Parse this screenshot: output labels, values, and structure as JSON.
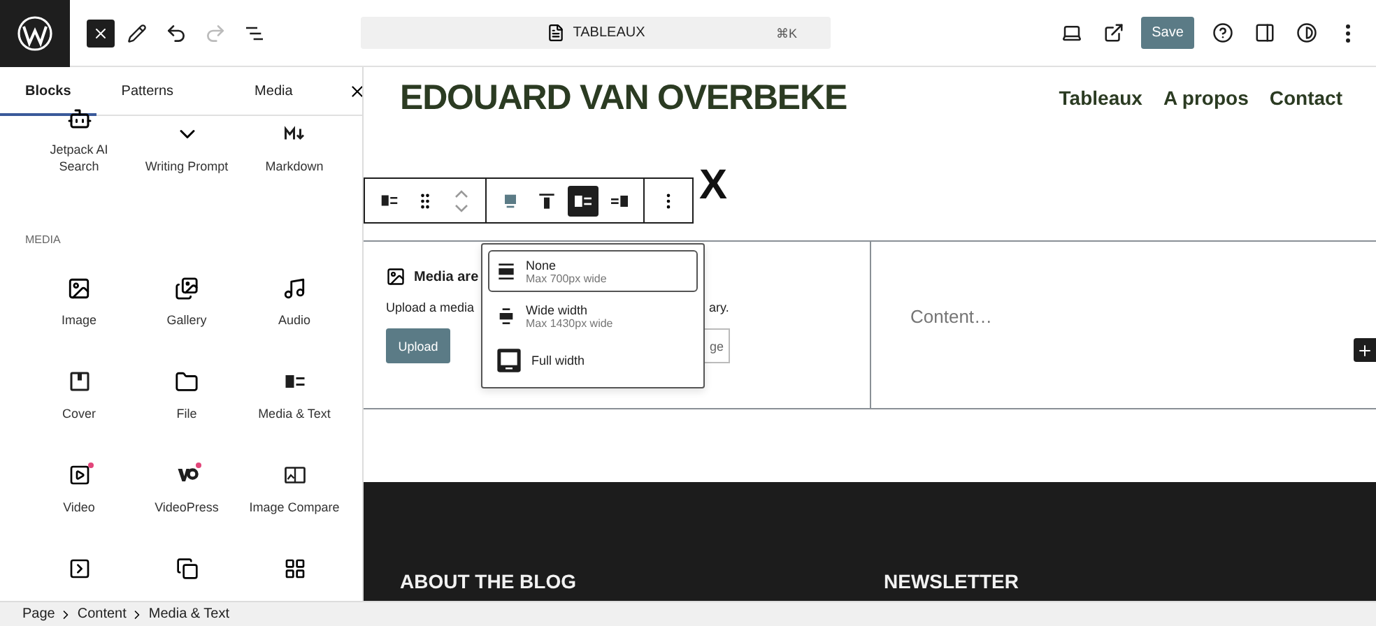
{
  "topbar": {
    "command": "TABLEAUX",
    "shortcut": "⌘K",
    "save": "Save"
  },
  "sidebar": {
    "tabs": [
      {
        "label": "Blocks",
        "selected": true
      },
      {
        "label": "Patterns",
        "selected": false
      },
      {
        "label": "Media",
        "selected": false
      }
    ],
    "sections": [
      {
        "items": [
          {
            "label": "Jetpack AI Search",
            "new": false
          },
          {
            "label": "Writing Prompt",
            "new": false
          },
          {
            "label": "Markdown",
            "new": false
          }
        ]
      },
      {
        "heading": "MEDIA",
        "items": [
          {
            "label": "Image",
            "new": false
          },
          {
            "label": "Gallery",
            "new": false
          },
          {
            "label": "Audio",
            "new": false
          },
          {
            "label": "Cover",
            "new": false
          },
          {
            "label": "File",
            "new": false
          },
          {
            "label": "Media & Text",
            "new": false
          },
          {
            "label": "Video",
            "new": true
          },
          {
            "label": "VideoPress",
            "new": true
          },
          {
            "label": "Image Compare",
            "new": false
          },
          {
            "new": false
          },
          {
            "new": false
          },
          {
            "new": false
          }
        ]
      }
    ]
  },
  "site": {
    "title": "EDOUARD VAN OVERBEKE",
    "nav": [
      "Tableaux",
      "A propos",
      "Contact"
    ],
    "page_heading": "X"
  },
  "block_toolbar": {
    "align_buttons": [
      {
        "selected": false
      },
      {
        "selected": false
      },
      {
        "selected": true
      },
      {
        "selected": false
      }
    ]
  },
  "media_text": {
    "media_label": "Media are",
    "description_start": "Upload a media",
    "description_end": "ary.",
    "upload": "Upload",
    "library": "ge",
    "content_placeholder": "Content…"
  },
  "width_menu": [
    {
      "label": "None",
      "hint": "Max 700px wide",
      "selected": true
    },
    {
      "label": "Wide width",
      "hint": "Max 1430px wide",
      "selected": false
    },
    {
      "label": "Full width",
      "selected": false
    }
  ],
  "footer": {
    "columns": [
      "ABOUT THE BLOG",
      "NEWSLETTER"
    ]
  },
  "breadcrumb": [
    "Page",
    "Content",
    "Media & Text"
  ]
}
